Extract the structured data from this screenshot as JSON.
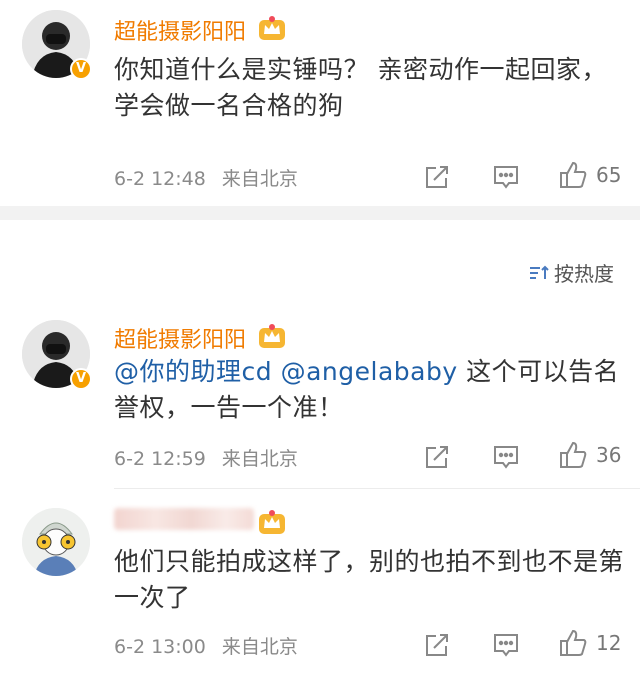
{
  "comments": [
    {
      "username": "超能摄影阳阳",
      "content": "你知道什么是实锤吗？ 亲密动作一起回家， 学会做一名合格的狗",
      "time": "6-2 12:48",
      "source": "来自北京",
      "likes": "65"
    }
  ],
  "sort": {
    "label": "按热度"
  },
  "replies": [
    {
      "username": "超能摄影阳阳",
      "mentions": [
        "@你的助理cd",
        "@angelababy"
      ],
      "content": " 这个可以告名誉权，一告一个准！",
      "time": "6-2 12:59",
      "source": "来自北京",
      "likes": "36"
    },
    {
      "username": "",
      "content": "他们只能拍成这样了，别的也拍不到也不是第一次了",
      "time": "6-2 13:00",
      "source": "来自北京",
      "likes": "12"
    }
  ],
  "colors": {
    "username": "#f07b00",
    "mention": "#1f5fa6",
    "meta": "#8a8a8a",
    "divider": "#f2f2f2"
  },
  "icons": [
    "share-icon",
    "comment-icon",
    "like-icon",
    "sort-icon",
    "crown-icon",
    "verified-badge-icon"
  ]
}
